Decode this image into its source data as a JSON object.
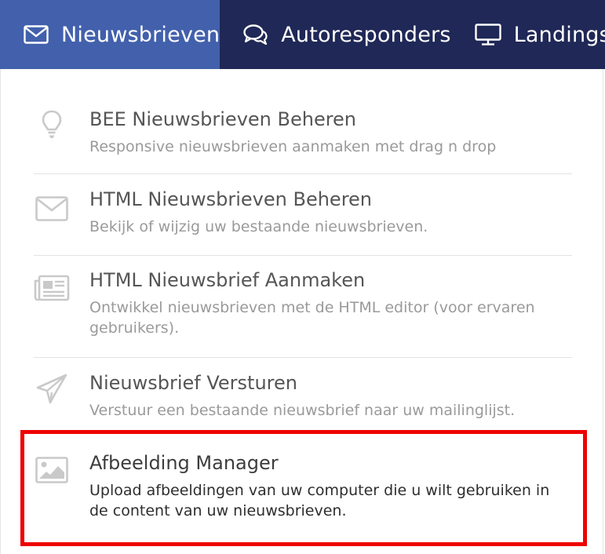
{
  "nav": {
    "tabs": [
      {
        "label": "Nieuwsbrieven",
        "icon": "envelope-icon",
        "active": true
      },
      {
        "label": "Autoresponders",
        "icon": "chat-bubbles-icon",
        "active": false
      },
      {
        "label": "Landingspagina's",
        "icon": "monitor-icon",
        "active": false
      }
    ]
  },
  "menu": {
    "items": [
      {
        "title": "BEE Nieuwsbrieven Beheren",
        "description": "Responsive nieuwsbrieven aanmaken met drag n drop",
        "icon": "lightbulb-icon"
      },
      {
        "title": "HTML Nieuwsbrieven Beheren",
        "description": "Bekijk of wijzig uw bestaande nieuwsbrieven.",
        "icon": "envelope-icon"
      },
      {
        "title": "HTML Nieuwsbrief Aanmaken",
        "description": "Ontwikkel nieuwsbrieven met de HTML editor (voor ervaren gebruikers).",
        "icon": "newspaper-icon"
      },
      {
        "title": "Nieuwsbrief Versturen",
        "description": "Verstuur een bestaande nieuwsbrief naar uw mailinglijst.",
        "icon": "paper-plane-icon"
      },
      {
        "title": "Afbeelding Manager",
        "description": "Upload afbeeldingen van uw computer die u wilt gebruiken in de content van uw nieuwsbrieven.",
        "icon": "image-icon"
      }
    ]
  },
  "colors": {
    "nav_background": "#1f2856",
    "nav_active": "#4260ac",
    "highlight_border": "#ee0000",
    "icon_gray": "#c9c9c9"
  }
}
